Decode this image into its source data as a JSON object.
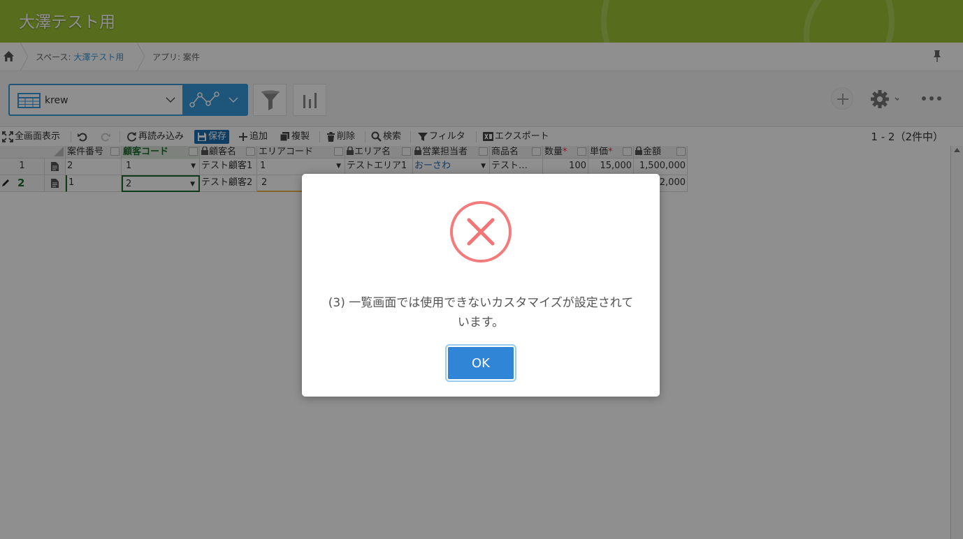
{
  "app": {
    "title": "大澤テスト用"
  },
  "breadcrumb": {
    "space_prefix": "スペース: ",
    "space_name": "大澤テスト用",
    "app_label": "アプリ: 案件"
  },
  "view": {
    "name": "krew"
  },
  "krew_toolbar": {
    "fullscreen": "全画面表示",
    "reload": "再読み込み",
    "save": "保存",
    "add": "追加",
    "copy": "複製",
    "delete": "削除",
    "search": "検索",
    "filter": "フィルタ",
    "export": "エクスポート",
    "record_count": "1 - 2（2件中）"
  },
  "grid": {
    "columns": [
      "案件番号",
      "顧客コード",
      "顧客名",
      "エリアコード",
      "エリア名",
      "営業担当者",
      "商品名",
      "数量",
      "単価",
      "金額"
    ],
    "rows": [
      {
        "row_no": "1",
        "case_no": "2",
        "customer_code": "1",
        "customer_name": "テスト顧客1",
        "area_code": "1",
        "area_name": "テストエリア1",
        "rep": "おーさわ",
        "product": "テスト…",
        "qty": "100",
        "price": "15,000",
        "amount": "1,500,000"
      },
      {
        "row_no": "2",
        "case_no": "1",
        "customer_code": "2",
        "customer_name": "テスト顧客2",
        "area_code": "2",
        "amount_partial": "2,000"
      }
    ],
    "required_mark": "*"
  },
  "modal": {
    "message_line1": "(3) 一覧画面では使用できないカスタマイズが設定されて",
    "message_line2": "います。",
    "ok_label": "OK"
  },
  "colors": {
    "header_green": "#9cc234",
    "accent_blue": "#3498db",
    "error_red": "#f27474",
    "ok_button": "#3085d6"
  }
}
